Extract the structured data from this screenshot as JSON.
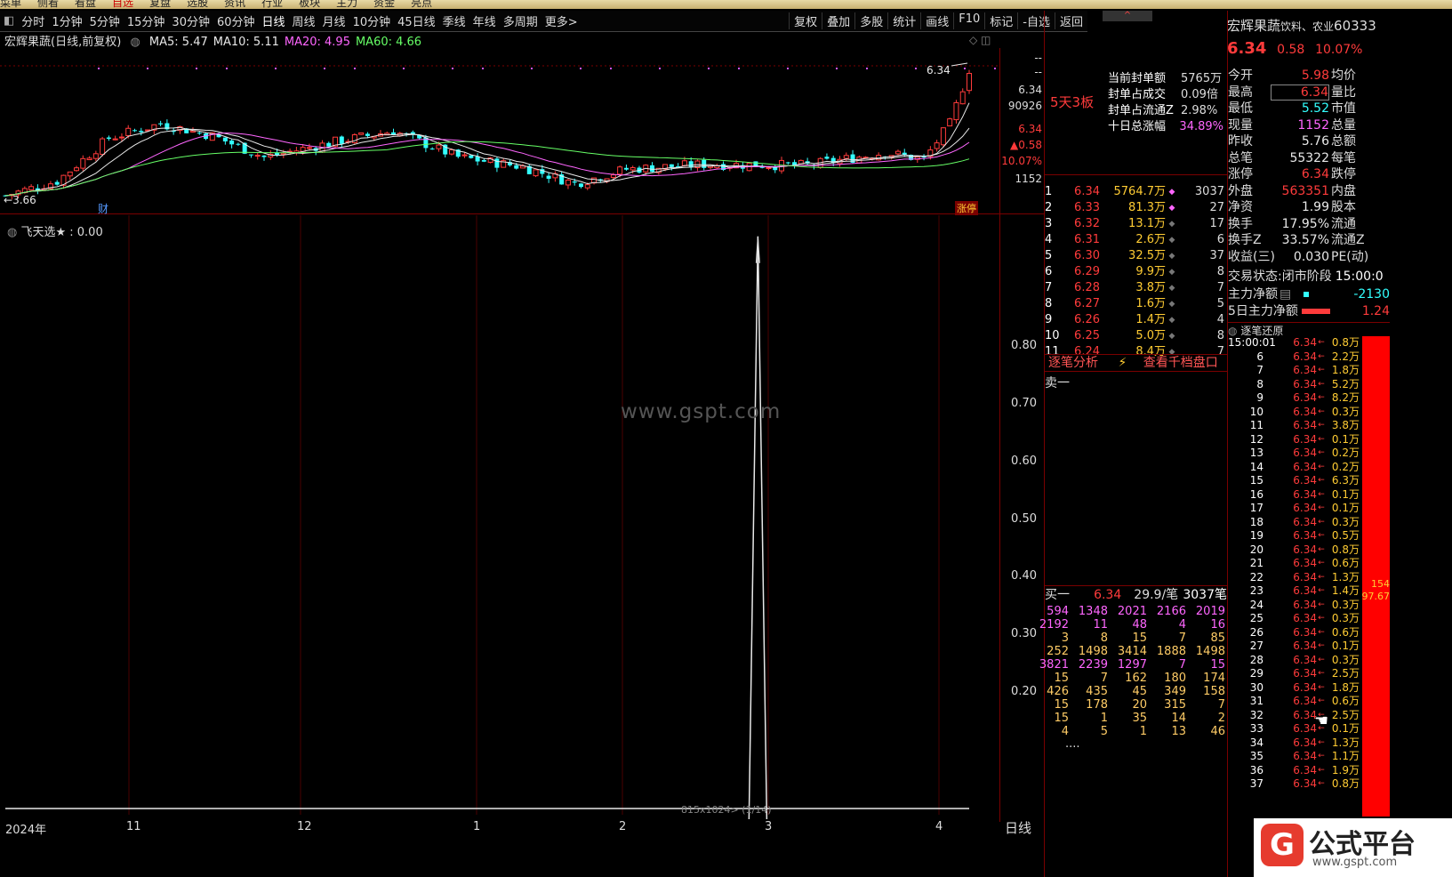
{
  "menubar": [
    "菜单",
    "侧看",
    "看盘",
    "自选",
    "复盘",
    "选股",
    "资讯",
    "行业",
    "板块",
    "主力",
    "资金",
    "亮点"
  ],
  "menubar_active": "自选",
  "toolbar": {
    "periods": [
      "分时",
      "1分钟",
      "5分钟",
      "15分钟",
      "30分钟",
      "60分钟",
      "日线",
      "周线",
      "月线",
      "10分钟",
      "45日线",
      "季线",
      "年线",
      "多周期",
      "更多>"
    ],
    "right": [
      "复权",
      "叠加",
      "多股",
      "统计",
      "画线",
      "F10",
      "标记",
      "-自选",
      "返回"
    ]
  },
  "chart": {
    "title": "宏辉果蔬(日线,前复权)",
    "ma": [
      {
        "label": "MA5: 5.47",
        "color": "#e8e8e8"
      },
      {
        "label": "MA10: 5.11",
        "color": "#e8e8e8"
      },
      {
        "label": "MA20: 4.95",
        "color": "#ff66ff"
      },
      {
        "label": "MA60: 4.66",
        "color": "#66ff66"
      }
    ],
    "high_label": "6.34",
    "low_label": "3.66",
    "cai_label": "财",
    "zhangting_label": "涨停",
    "right_axis": [
      "--",
      "--",
      "6.34",
      "90926",
      "6.34",
      "▲0.58",
      "10.07%",
      "1152"
    ],
    "indicator_label": "飞天选★ : 0.00",
    "y_ticks": [
      "0.80",
      "0.70",
      "0.60",
      "0.50",
      "0.40",
      "0.30",
      "0.20"
    ],
    "x_ticks": [
      "2024年",
      "11",
      "12",
      "1",
      "2",
      "3",
      "4"
    ],
    "period_label": "日线",
    "watermark": "www.gspt.com",
    "status_text": "815x1024> (1/14)"
  },
  "chart_data": {
    "type": "line",
    "title": "飞天选★",
    "x": [
      "2024年",
      "11",
      "12",
      "1",
      "2",
      "3",
      "4"
    ],
    "y_ticks": [
      0.2,
      0.3,
      0.4,
      0.5,
      0.6,
      0.7,
      0.8
    ],
    "series": [
      {
        "name": "飞天选★",
        "spike_position": 0.79,
        "peak": 0.99,
        "current": 0.0
      }
    ],
    "price_range": [
      3.66,
      6.34
    ]
  },
  "panel": {
    "stock_name": "宏辉果蔬",
    "industry": "饮料、农业",
    "code": "60333",
    "price": "6.34",
    "change": "0.58",
    "change_pct": "10.07%",
    "board": "5天3板",
    "seal": [
      {
        "k": "当前封单额",
        "v": "5765万"
      },
      {
        "k": "封单占成交",
        "v": "0.09倍"
      },
      {
        "k": "封单占流通Z",
        "v": "2.98%"
      },
      {
        "k": "十日总涨幅",
        "v": "34.89%"
      }
    ],
    "quote": [
      {
        "k": "今开",
        "v": "5.98",
        "c": "red",
        "k2": "均价"
      },
      {
        "k": "最高",
        "v": "6.34",
        "c": "red",
        "k2": "量比"
      },
      {
        "k": "最低",
        "v": "5.52",
        "c": "green",
        "k2": "市值"
      },
      {
        "k": "现量",
        "v": "1152",
        "c": "magenta",
        "k2": "总量"
      },
      {
        "k": "昨收",
        "v": "5.76",
        "c": "white",
        "k2": "总额"
      },
      {
        "k": "总笔",
        "v": "55322",
        "c": "white",
        "k2": "每笔"
      },
      {
        "k": "涨停",
        "v": "6.34",
        "c": "red",
        "k2": "跌停"
      },
      {
        "k": "外盘",
        "v": "563351",
        "c": "red",
        "k2": "内盘"
      },
      {
        "k": "净资",
        "v": "1.99",
        "c": "white",
        "k2": "股本"
      },
      {
        "k": "换手",
        "v": "17.95%",
        "c": "white",
        "k2": "流通"
      },
      {
        "k": "换手Z",
        "v": "33.57%",
        "c": "white",
        "k2": "流通Z"
      },
      {
        "k": "收益(三)",
        "v": "0.030",
        "c": "white",
        "k2": "PE(动)"
      }
    ],
    "trade_status_label": "交易状态:",
    "trade_status": "闭市阶段",
    "trade_time": "15:00:0",
    "main_net_label": "主力净额",
    "main_net": "-2130",
    "main_net5_label": "5日主力净额",
    "main_net5": "1.24",
    "orderbook": [
      {
        "n": "1",
        "p": "6.34",
        "v": "5764.7万",
        "c": "3037"
      },
      {
        "n": "2",
        "p": "6.33",
        "v": "81.3万",
        "c": "27"
      },
      {
        "n": "3",
        "p": "6.32",
        "v": "13.1万",
        "c": "17"
      },
      {
        "n": "4",
        "p": "6.31",
        "v": "2.6万",
        "c": "6"
      },
      {
        "n": "5",
        "p": "6.30",
        "v": "32.5万",
        "c": "37"
      },
      {
        "n": "6",
        "p": "6.29",
        "v": "9.9万",
        "c": "8"
      },
      {
        "n": "7",
        "p": "6.28",
        "v": "3.8万",
        "c": "7"
      },
      {
        "n": "8",
        "p": "6.27",
        "v": "1.6万",
        "c": "5"
      },
      {
        "n": "9",
        "p": "6.26",
        "v": "1.4万",
        "c": "4"
      },
      {
        "n": "10",
        "p": "6.25",
        "v": "5.0万",
        "c": "8"
      },
      {
        "n": "11",
        "p": "6.24",
        "v": "8.4万",
        "c": "7"
      }
    ],
    "tick_analysis": "逐笔分析",
    "view_depth": "查看千档盘口",
    "sell1": "卖一",
    "buy1": {
      "label": "买一",
      "price": "6.34",
      "per": "29.9/笔",
      "count": "3037笔"
    },
    "buy_detail": [
      [
        "594",
        "1348",
        "2021",
        "2166",
        "2019"
      ],
      [
        "2192",
        "11",
        "48",
        "4",
        "16"
      ],
      [
        "3",
        "8",
        "15",
        "7",
        "85"
      ],
      [
        "252",
        "1498",
        "3414",
        "1888",
        "1498"
      ],
      [
        "3821",
        "2239",
        "1297",
        "7",
        "15"
      ],
      [
        "15",
        "7",
        "162",
        "180",
        "174"
      ],
      [
        "426",
        "435",
        "45",
        "349",
        "158"
      ],
      [
        "15",
        "178",
        "20",
        "315",
        "7"
      ],
      [
        "15",
        "1",
        "35",
        "14",
        "2"
      ],
      [
        "4",
        "5",
        "1",
        "13",
        "46"
      ]
    ],
    "buy_more": "....",
    "tick_title": "逐笔还原",
    "ticks": [
      {
        "t": "15:00:01",
        "p": "6.34",
        "v": "0.8万"
      },
      {
        "t": "6",
        "p": "6.34",
        "v": "2.2万"
      },
      {
        "t": "7",
        "p": "6.34",
        "v": "1.8万"
      },
      {
        "t": "8",
        "p": "6.34",
        "v": "5.2万"
      },
      {
        "t": "9",
        "p": "6.34",
        "v": "8.2万"
      },
      {
        "t": "10",
        "p": "6.34",
        "v": "0.3万"
      },
      {
        "t": "11",
        "p": "6.34",
        "v": "3.8万"
      },
      {
        "t": "12",
        "p": "6.34",
        "v": "0.1万"
      },
      {
        "t": "13",
        "p": "6.34",
        "v": "0.2万"
      },
      {
        "t": "14",
        "p": "6.34",
        "v": "0.2万"
      },
      {
        "t": "15",
        "p": "6.34",
        "v": "6.3万"
      },
      {
        "t": "16",
        "p": "6.34",
        "v": "0.1万"
      },
      {
        "t": "17",
        "p": "6.34",
        "v": "0.1万"
      },
      {
        "t": "18",
        "p": "6.34",
        "v": "0.3万"
      },
      {
        "t": "19",
        "p": "6.34",
        "v": "0.5万"
      },
      {
        "t": "20",
        "p": "6.34",
        "v": "0.8万"
      },
      {
        "t": "21",
        "p": "6.34",
        "v": "0.6万"
      },
      {
        "t": "22",
        "p": "6.34",
        "v": "1.3万"
      },
      {
        "t": "23",
        "p": "6.34",
        "v": "1.4万"
      },
      {
        "t": "24",
        "p": "6.34",
        "v": "0.3万"
      },
      {
        "t": "25",
        "p": "6.34",
        "v": "0.3万"
      },
      {
        "t": "26",
        "p": "6.34",
        "v": "0.6万"
      },
      {
        "t": "27",
        "p": "6.34",
        "v": "0.1万"
      },
      {
        "t": "28",
        "p": "6.34",
        "v": "0.3万"
      },
      {
        "t": "29",
        "p": "6.34",
        "v": "2.5万"
      },
      {
        "t": "30",
        "p": "6.34",
        "v": "1.8万"
      },
      {
        "t": "31",
        "p": "6.34",
        "v": "0.6万"
      },
      {
        "t": "32",
        "p": "6.34",
        "v": "2.5万"
      },
      {
        "t": "33",
        "p": "6.34",
        "v": "0.1万"
      },
      {
        "t": "34",
        "p": "6.34",
        "v": "1.3万"
      },
      {
        "t": "35",
        "p": "6.34",
        "v": "1.1万"
      },
      {
        "t": "36",
        "p": "6.34",
        "v": "1.9万"
      },
      {
        "t": "37",
        "p": "6.34",
        "v": "0.8万"
      }
    ],
    "bar_text1": "154",
    "bar_text2": "97.67",
    "logo_text": "公式平台",
    "logo_url": "www.gspt.com"
  }
}
